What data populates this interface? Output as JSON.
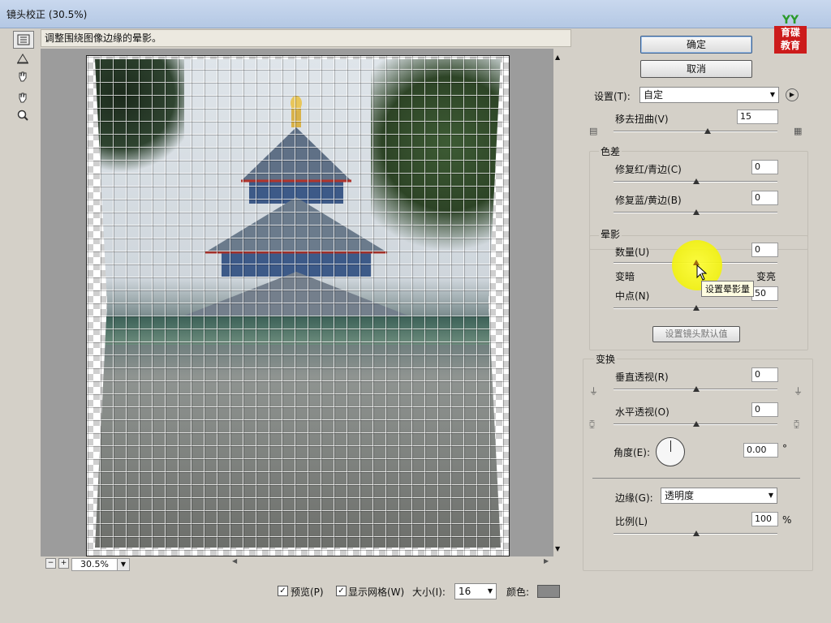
{
  "window": {
    "title": "镜头校正 (30.5%)"
  },
  "hint": "调整围绕图像边缘的晕影。",
  "logo": {
    "top": "YY",
    "line1": "育碟",
    "line2": "教育"
  },
  "tools": [
    {
      "icon": "remove-distortion-tool-icon"
    },
    {
      "icon": "straighten-tool-icon"
    },
    {
      "icon": "move-grid-tool-icon"
    },
    {
      "icon": "hand-tool-icon"
    },
    {
      "icon": "zoom-tool-icon"
    }
  ],
  "zoom": {
    "value": "30.5%",
    "minus": "−",
    "plus": "+"
  },
  "bottom": {
    "preview_label": "预览(P)",
    "show_grid_label": "显示网格(W)",
    "size_label": "大小(I):",
    "size_value": "16",
    "color_label": "颜色:",
    "grid_color": "#888888"
  },
  "buttons": {
    "ok": "确定",
    "cancel": "取消",
    "set_defaults": "设置镜头默认值"
  },
  "settings": {
    "label": "设置(T):",
    "value": "自定"
  },
  "remove_distortion": {
    "label": "移去扭曲(V)",
    "value": "15",
    "level": 15
  },
  "chromatic": {
    "title": "色差",
    "red_cyan": {
      "label": "修复红/青边(C)",
      "value": "0"
    },
    "blue_yellow": {
      "label": "修复蓝/黄边(B)",
      "value": "0"
    }
  },
  "vignette": {
    "title": "晕影",
    "amount": {
      "label": "数量(U)",
      "value": "0",
      "left": "变暗",
      "right": "变亮"
    },
    "midpoint": {
      "label": "中点(N)",
      "value": "50"
    },
    "tooltip": "设置晕影量"
  },
  "transform": {
    "title": "变换",
    "vertical": {
      "label": "垂直透视(R)",
      "value": "0"
    },
    "horizontal": {
      "label": "水平透视(O)",
      "value": "0"
    },
    "angle": {
      "label": "角度(E):",
      "value": "0.00",
      "unit": "°"
    },
    "edge": {
      "label": "边缘(G):",
      "value": "透明度"
    },
    "scale": {
      "label": "比例(L)",
      "value": "100",
      "unit": "%"
    }
  },
  "colors": {
    "accent_yellow": "#f0f000",
    "logo_red": "#cc1b1b",
    "logo_green": "#2a9a2a"
  }
}
